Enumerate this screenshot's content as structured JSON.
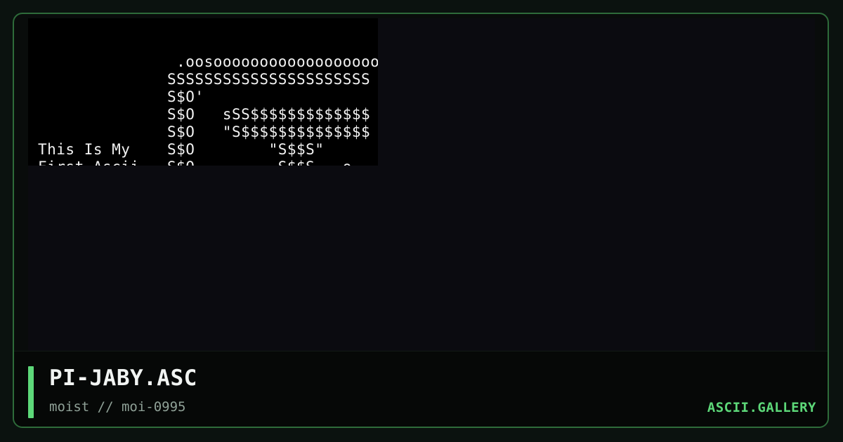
{
  "art": {
    "filename": "PI-JABY.ASC",
    "lines": [
      "               .oosoooooooooooooooooo",
      "              SSSSSSSSSSSSSSSSSSSSSS",
      "              S$O'",
      "              S$O   sSS$$$$$$$$$$$$$",
      "              S$O   \"S$$$$$$$$$$$$$$",
      "This Is My    S$O        \"S$$S\"",
      "First Ascii   S$O         S$$S   o"
    ]
  },
  "footer": {
    "title": "PI-JABY.ASC",
    "subtitle": "moist // moi-0995",
    "site": "ASCII.GALLERY"
  },
  "colors": {
    "accent": "#5dd879",
    "frame_border": "#2e6b3a",
    "art_background": "#000000",
    "panel_background": "#0b0b10"
  }
}
